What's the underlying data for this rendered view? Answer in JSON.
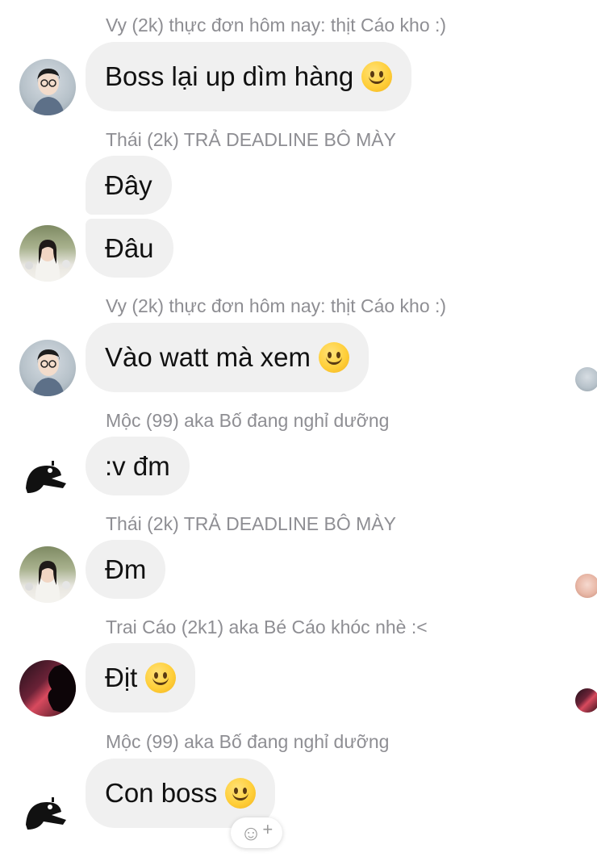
{
  "messages": [
    {
      "sender": "Vy (2k) thực đơn hôm nay: thịt Cáo kho :)",
      "text": "Boss lại up dìm hàng"
    },
    {
      "sender": "Thái (2k) TRẢ DEADLINE BÔ MÀY",
      "text": "Đây"
    },
    {
      "text": "Đâu"
    },
    {
      "sender": "Vy (2k) thực đơn hôm nay: thịt Cáo kho :)",
      "text": "Vào watt mà xem"
    },
    {
      "sender": "Mộc (99) aka Bố đang nghỉ dưỡng",
      "text": ":v đm"
    },
    {
      "sender": "Thái (2k) TRẢ DEADLINE BÔ MÀY",
      "text": "Đm"
    },
    {
      "sender": "Trai Cáo (2k1) aka Bé Cáo khóc nhè :<",
      "text": "Địt"
    },
    {
      "sender": "Mộc (99) aka Bố đang nghỉ dưỡng",
      "text": "Con boss"
    }
  ],
  "icons": {
    "emoji": "slightly-smiling-face-icon",
    "reaction": "add-reaction-icon"
  },
  "reaction_button": {
    "glyph": "☺",
    "plus": "+"
  },
  "colors": {
    "bubble": "#f0f0f0",
    "sender_text": "#8e8e93"
  }
}
